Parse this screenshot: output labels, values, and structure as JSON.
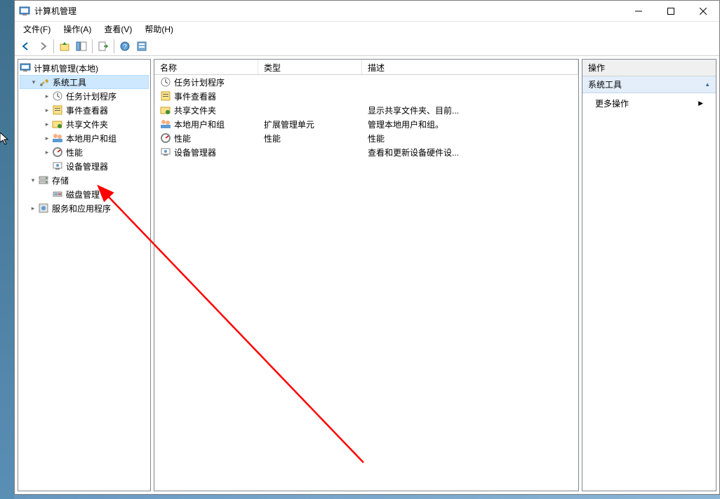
{
  "window_title": "计算机管理",
  "menus": {
    "file": "文件(F)",
    "action": "操作(A)",
    "view": "查看(V)",
    "help": "帮助(H)"
  },
  "tree": {
    "root": "计算机管理(本地)",
    "system_tools": "系统工具",
    "task_scheduler": "任务计划程序",
    "event_viewer": "事件查看器",
    "shared_folders": "共享文件夹",
    "local_users": "本地用户和组",
    "performance": "性能",
    "device_manager": "设备管理器",
    "storage": "存储",
    "disk_management": "磁盘管理",
    "services_apps": "服务和应用程序"
  },
  "list": {
    "columns": {
      "name": "名称",
      "type": "类型",
      "desc": "描述"
    },
    "rows": [
      {
        "icon": "clock",
        "name": "任务计划程序",
        "type": "",
        "desc": ""
      },
      {
        "icon": "event",
        "name": "事件查看器",
        "type": "",
        "desc": ""
      },
      {
        "icon": "folder-share",
        "name": "共享文件夹",
        "type": "",
        "desc": "显示共享文件夹、目前..."
      },
      {
        "icon": "users",
        "name": "本地用户和组",
        "type": "扩展管理单元",
        "desc": "管理本地用户和组。"
      },
      {
        "icon": "perf",
        "name": "性能",
        "type": "性能",
        "desc": "性能"
      },
      {
        "icon": "device",
        "name": "设备管理器",
        "type": "",
        "desc": "查看和更新设备硬件设..."
      }
    ]
  },
  "actions": {
    "header": "操作",
    "group": "系统工具",
    "more": "更多操作"
  },
  "col_widths": {
    "name": 148,
    "type": 148,
    "desc": 200
  }
}
